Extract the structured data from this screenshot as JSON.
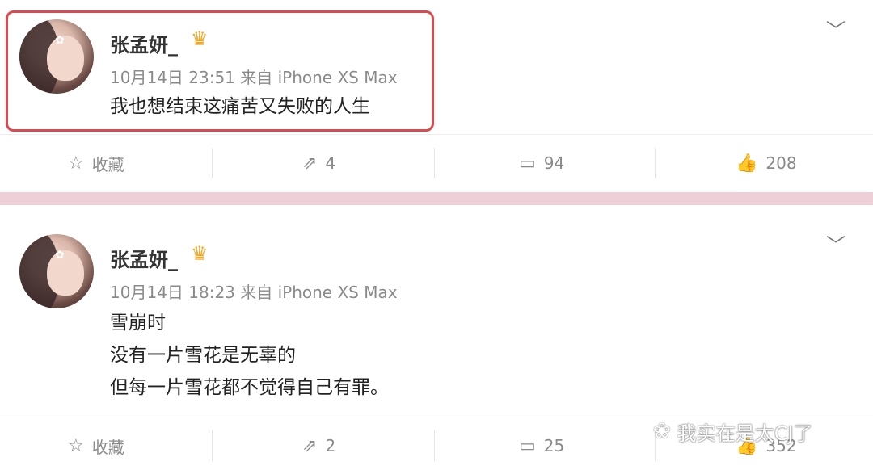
{
  "posts": [
    {
      "username": "张孟妍_",
      "crown_icon": "crown-icon",
      "timestamp": "10月14日 23:51 来自 iPhone XS Max",
      "lines": [
        "我也想结束这痛苦又失败的人生"
      ],
      "highlight_color": "#e0484f",
      "actions": {
        "favorite": "收藏",
        "repost": "4",
        "comment": "94",
        "like": "208"
      }
    },
    {
      "username": "张孟妍_",
      "crown_icon": "crown-icon",
      "timestamp": "10月14日 18:23 来自 iPhone XS Max",
      "lines": [
        "雪崩时",
        "没有一片雪花是无辜的",
        "但每一片雪花都不觉得自己有罪。"
      ],
      "actions": {
        "favorite": "收藏",
        "repost": "2",
        "comment": "25",
        "like": "352"
      }
    }
  ],
  "divider_color": "#efcfd7",
  "watermark": "我实在是太CJ了"
}
